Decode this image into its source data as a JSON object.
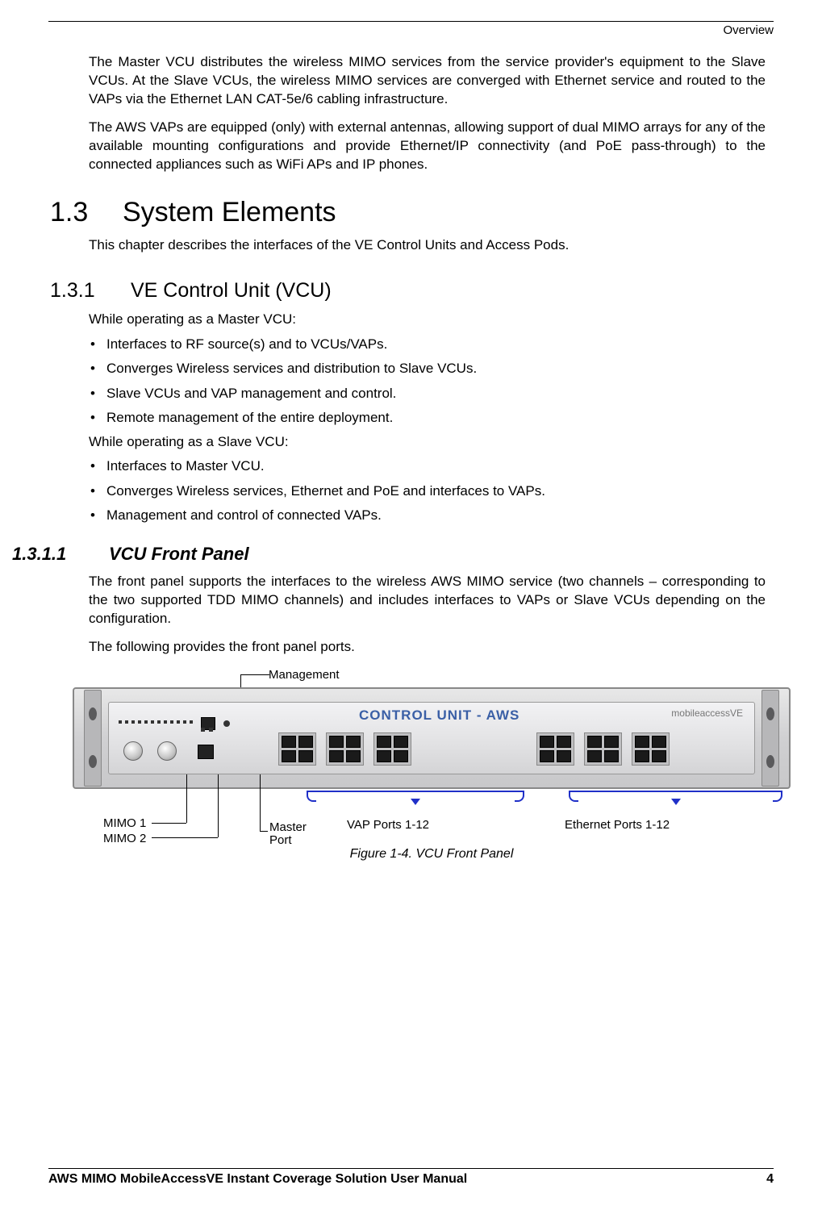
{
  "header": {
    "section": "Overview"
  },
  "para1": "The Master VCU distributes the wireless MIMO services from the service provider's equipment to the Slave VCUs. At the Slave VCUs, the wireless MIMO services are converged with Ethernet service and routed to the VAPs via the Ethernet LAN CAT-5e/6 cabling infrastructure.",
  "para2": "The AWS VAPs are equipped (only) with external antennas, allowing support of dual MIMO arrays for any of the available mounting configurations and provide Ethernet/IP connectivity (and PoE pass-through) to the connected appliances such as WiFi APs and IP phones.",
  "h1": {
    "num": "1.3",
    "title": "System Elements"
  },
  "h1_intro": "This chapter describes the interfaces of the VE Control Units and Access Pods.",
  "h2": {
    "num": "1.3.1",
    "title": "VE Control Unit (VCU)"
  },
  "master_intro": "While operating as a Master VCU:",
  "master_bullets": [
    "Interfaces to RF source(s) and to VCUs/VAPs.",
    "Converges Wireless services and distribution to Slave VCUs.",
    "Slave VCUs and VAP management and control.",
    "Remote management of the entire deployment."
  ],
  "slave_intro": "While operating as a Slave VCU:",
  "slave_bullets": [
    "Interfaces to Master VCU.",
    "Converges Wireless services, Ethernet and PoE and interfaces to VAPs.",
    "Management and control of connected VAPs."
  ],
  "h3": {
    "num": "1.3.1.1",
    "title": "VCU Front Panel"
  },
  "h3_p1": "The front panel supports the interfaces to the wireless AWS MIMO service (two channels – corresponding to the two supported TDD MIMO channels) and includes interfaces to VAPs or Slave VCUs depending on the configuration.",
  "h3_p2": "The following provides the front panel ports.",
  "figure": {
    "management": "Management",
    "mimo1": "MIMO 1",
    "mimo2": "MIMO 2",
    "master_port": "Master Port",
    "vap_ports": "VAP Ports 1-12",
    "eth_ports": "Ethernet Ports 1-12",
    "caption": "Figure 1-4. VCU Front Panel",
    "device_title": "CONTROL UNIT - AWS",
    "brand": "mobileaccessVE"
  },
  "footer": {
    "title": "AWS MIMO MobileAccessVE Instant Coverage Solution User Manual",
    "page": "4"
  }
}
